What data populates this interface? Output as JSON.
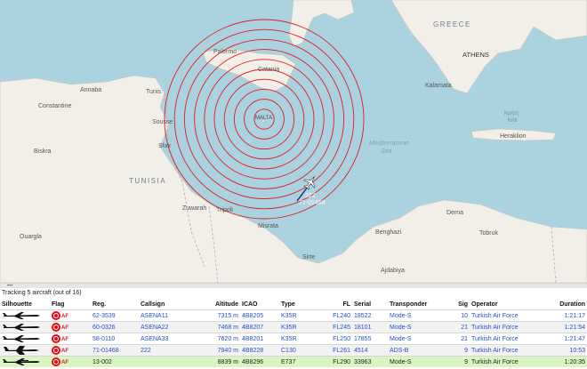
{
  "map": {
    "countries": {
      "greece": "GREECE",
      "tunisia": "TUNISIA",
      "malta": "MALTA"
    },
    "sea": "Mediterranean\nSea",
    "cities": {
      "palermo": "Palermo",
      "catania": "Catania",
      "annaba": "Annaba",
      "tunis": "Tunis",
      "constantine": "Constantine",
      "sousse": "Sousse",
      "sfax": "Sfax",
      "biskra": "Biskra",
      "ouargla": "Ouargla",
      "zuwarah": "Zuwarah",
      "tripoli": "Tripoli",
      "misrata": "Misrata",
      "sirte": "Sirte",
      "benghazi": "Benghazi",
      "ajdabiya": "Ajdabiya",
      "tobruk": "Tobruk",
      "derna": "Derna",
      "athens": "ATHENS",
      "kalamata": "Kalamata",
      "heraklion": "Heraklion",
      "kriti": "Κρήτη\nKriti"
    },
    "aircraft_label_line1": "222",
    "aircraft_label_line2": "71-01468"
  },
  "status": "Tracking 5 aircraft (out of 16)",
  "table": {
    "headers": {
      "silhouette": "Silhouette",
      "flag": "Flag",
      "reg": "Reg.",
      "callsign": "Callsign",
      "altitude": "Altitude",
      "icao": "ICAO",
      "type": "Type",
      "fl": "FL",
      "serial": "Serial",
      "transponder": "Transponder",
      "sig": "Sig",
      "operator": "Operator",
      "duration": "Duration"
    },
    "rows": [
      {
        "af": "AF",
        "reg": "62-3539",
        "callsign": "ASENA11",
        "altitude": "7315 m",
        "icao": "4B8205",
        "type": "K35R",
        "fl": "FL240",
        "serial": "18522",
        "transponder": "Mode-S",
        "sig": "10",
        "operator": "Turkish Air Force",
        "duration": "1:21:17"
      },
      {
        "af": "AF",
        "reg": "60-0326",
        "callsign": "ASENA22",
        "altitude": "7468 m",
        "icao": "4B8207",
        "type": "K35R",
        "fl": "FL245",
        "serial": "18101",
        "transponder": "Mode-S",
        "sig": "21",
        "operator": "Turkish Air Force",
        "duration": "1:21:54"
      },
      {
        "af": "AF",
        "reg": "58-0110",
        "callsign": "ASENA33",
        "altitude": "7620 m",
        "icao": "4B8201",
        "type": "K35R",
        "fl": "FL250",
        "serial": "17855",
        "transponder": "Mode-S",
        "sig": "21",
        "operator": "Turkish Air Force",
        "duration": "1:21:47"
      },
      {
        "af": "AF",
        "reg": "71-01468",
        "callsign": "222",
        "altitude": "7940 m",
        "icao": "4B8228",
        "type": "C130",
        "fl": "FL261",
        "serial": "4514",
        "transponder": "ADS-B",
        "sig": "9",
        "operator": "Turkish Air Force",
        "duration": "10:53"
      },
      {
        "af": "AF",
        "reg": "13-002",
        "callsign": "",
        "altitude": "8839 m",
        "icao": "4B8296",
        "type": "E737",
        "fl": "FL290",
        "serial": "33963",
        "transponder": "Mode-S",
        "sig": "9",
        "operator": "Turkish Air Force",
        "duration": "1:20:35"
      }
    ]
  },
  "colors": {
    "sea": "#aad3df",
    "land": "#f2efe9",
    "rings": "#e3191e",
    "selected_row": "#d9f5c1",
    "link": "#2450c7"
  }
}
